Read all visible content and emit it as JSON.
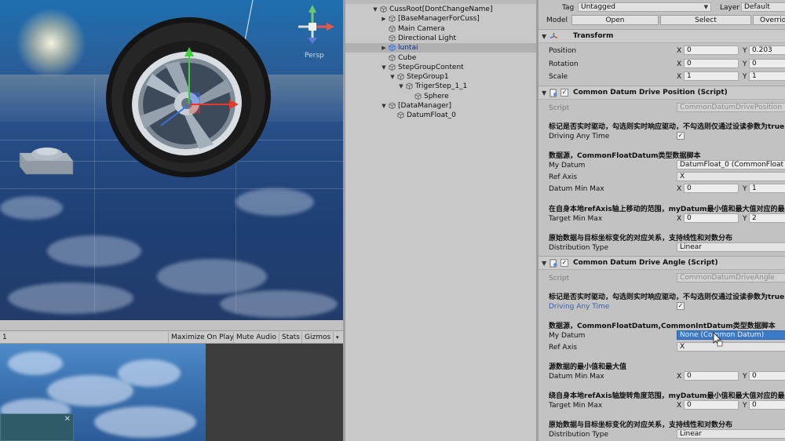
{
  "scene_view": {
    "gizmo": {
      "y_label": "y",
      "perspective_label": "Persp"
    }
  },
  "game_toolbar": {
    "display_label": "1",
    "maximize_label": "Maximize On Play",
    "mute_label": "Mute Audio",
    "stats_label": "Stats",
    "gizmos_label": "Gizmos"
  },
  "game_view": {
    "mini_dialog_close": "×"
  },
  "hierarchy": {
    "scene_name": "Luntai",
    "items": [
      {
        "label": "CussRoot[DontChangeName]",
        "indent": 0,
        "arrow": "▼",
        "selected": false,
        "blue": false
      },
      {
        "label": "[BaseManagerForCuss]",
        "indent": 1,
        "arrow": "▶",
        "selected": false,
        "blue": false
      },
      {
        "label": "Main Camera",
        "indent": 1,
        "arrow": "",
        "selected": false,
        "blue": false
      },
      {
        "label": "Directional Light",
        "indent": 1,
        "arrow": "",
        "selected": false,
        "blue": false
      },
      {
        "label": "luntai",
        "indent": 1,
        "arrow": "▶",
        "selected": true,
        "blue": true
      },
      {
        "label": "Cube",
        "indent": 1,
        "arrow": "",
        "selected": false,
        "blue": false
      },
      {
        "label": "StepGroupContent",
        "indent": 1,
        "arrow": "▼",
        "selected": false,
        "blue": false
      },
      {
        "label": "StepGroup1",
        "indent": 2,
        "arrow": "▼",
        "selected": false,
        "blue": false
      },
      {
        "label": "TrigerStep_1_1",
        "indent": 3,
        "arrow": "▼",
        "selected": false,
        "blue": false
      },
      {
        "label": "Sphere",
        "indent": 4,
        "arrow": "",
        "selected": false,
        "blue": false
      },
      {
        "label": "[DataManager]",
        "indent": 1,
        "arrow": "▼",
        "selected": false,
        "blue": false
      },
      {
        "label": "DatumFloat_0",
        "indent": 2,
        "arrow": "",
        "selected": false,
        "blue": false
      }
    ]
  },
  "inspector": {
    "tag_label": "Tag",
    "tag_value": "Untagged",
    "layer_label": "Layer",
    "layer_value": "Default",
    "model_label": "Model",
    "open_label": "Open",
    "select_label": "Select",
    "overrides_label": "Overrid",
    "transform": {
      "title": "Transform",
      "position_label": "Position",
      "rotation_label": "Rotation",
      "scale_label": "Scale",
      "position": {
        "x": "0",
        "y": "0.203"
      },
      "rotation": {
        "x": "0",
        "y": "0"
      },
      "scale": {
        "x": "1",
        "y": "1"
      }
    },
    "axis_x": "X",
    "axis_y": "Y",
    "drive_position": {
      "title": "Common Datum Drive Position (Script)",
      "script_label": "Script",
      "script_value": "CommonDatumDrivePosition",
      "note_driving": "标记是否实时驱动，勾选则实时响应驱动，不勾选则仅通过设读参数为true",
      "driving_label": "Driving Any Time",
      "driving_checked": "✓",
      "note_datum": "数据源，CommonFloatDatum类型数据脚本",
      "my_datum_label": "My Datum",
      "my_datum_value": "DatumFloat_0 (CommonFloat",
      "ref_axis_label": "Ref Axis",
      "ref_axis_value": "X",
      "datum_min_max_label": "Datum Min Max",
      "datum_min_max": {
        "x": "0",
        "y": "1"
      },
      "note_target": "在自身本地refAxis轴上移动的范围，myDatum最小值和最大值对应的最小",
      "target_min_max_label": "Target Min Max",
      "target_min_max": {
        "x": "0",
        "y": "2"
      },
      "note_distribution": "原始数据与目标坐标变化的对应关系，支持线性和对数分布",
      "distribution_label": "Distribution Type",
      "distribution_value": "Linear"
    },
    "drive_angle": {
      "title": "Common Datum Drive Angle (Script)",
      "script_label": "Script",
      "script_value": "CommonDatumDriveAngle",
      "note_driving": "标记是否实时驱动，勾选则实时响应驱动，不勾选则仅通过设读参数为true",
      "driving_label": "Driving Any Time",
      "driving_checked": "✓",
      "note_datum": "数据源，CommonFloatDatum,CommonIntDatum类型数据脚本",
      "my_datum_label": "My Datum",
      "my_datum_value": "None (Common Datum)",
      "ref_axis_label": "Ref Axis",
      "ref_axis_value": "X",
      "note_source_range": "源数据的最小值和最大值",
      "datum_min_max_label": "Datum Min Max",
      "datum_min_max": {
        "x": "0",
        "y": "0"
      },
      "note_target": "绕自身本地refAxis轴旋转角度范围，myDatum最小值和最大值对应的最小",
      "target_min_max_label": "Target Min Max",
      "target_min_max": {
        "x": "0",
        "y": "0"
      },
      "note_distribution": "原始数据与目标坐标变化的对应关系，支持线性和对数分布",
      "distribution_label": "Distribution Type",
      "distribution_value": "Linear"
    }
  }
}
